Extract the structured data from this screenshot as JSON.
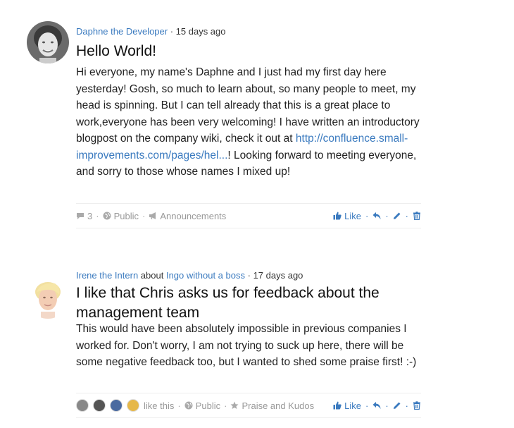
{
  "posts": [
    {
      "author": "Daphne the Developer",
      "time": "· 15 days ago",
      "title": "Hello World!",
      "body_before": "Hi everyone, my name's Daphne and I just had my first day here yesterday! Gosh, so much to learn about, so many people to meet, my head is spinning. But I can tell already that this is a great place to work,everyone has been very welcoming! I have written an introductory blogpost on the company wiki, check it out at ",
      "body_link": "http://confluence.small-improvements.com/pages/hel...",
      "body_after": "! Looking forward to meeting everyone, and sorry to those whose names I mixed up!",
      "comments": "3",
      "visibility": "Public",
      "category": "Announcements",
      "like_label": "Like"
    },
    {
      "author": "Irene the Intern",
      "about_word": "about",
      "about_target": "Ingo without a boss",
      "time": "· 17 days ago",
      "title": "I like that Chris asks us for feedback about the management team",
      "body": "This would have been absolutely impossible in previous companies I worked for. Don't worry, I am not trying to suck up here, there will be some negative feedback too, but I wanted to shed some praise first! :-)",
      "likes_text": "like this",
      "visibility": "Public",
      "category": "Praise and Kudos",
      "like_label": "Like"
    }
  ],
  "colors": {
    "link": "#3a7abf",
    "muted": "#999999"
  },
  "icons": [
    "comment-icon",
    "globe-icon",
    "megaphone-icon",
    "thumbs-up-icon",
    "reply-icon",
    "pencil-icon",
    "trash-icon",
    "star-icon"
  ]
}
